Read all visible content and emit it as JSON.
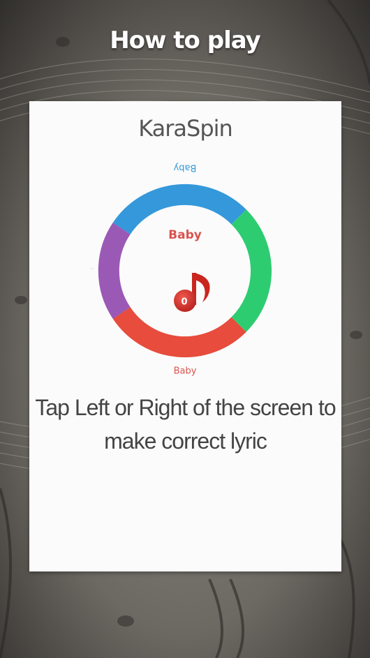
{
  "header": {
    "title": "How to play"
  },
  "card": {
    "title": "KaraSpin",
    "instruction": "Tap Left or Right of the screen to make correct lyric"
  },
  "wheel": {
    "top_label": "Baby",
    "center_label": "Baby",
    "bottom_label": "Baby",
    "score": "0",
    "colors": {
      "top": "#3498db",
      "right": "#2ecc71",
      "bottom": "#e74c3c",
      "left": "#9b59b6",
      "note": "#d6322b",
      "label": "#d9534f"
    }
  }
}
